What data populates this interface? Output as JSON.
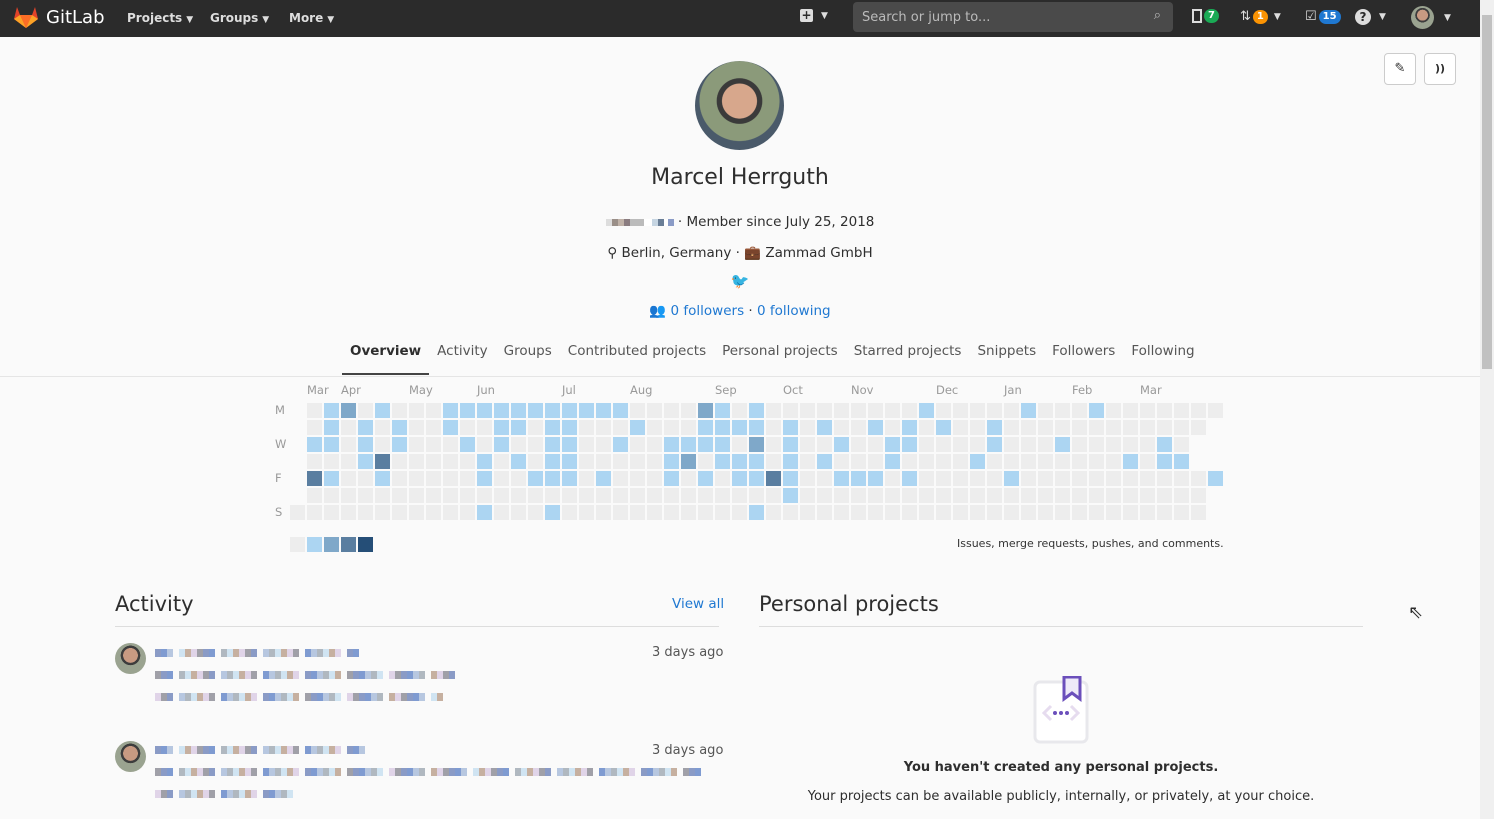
{
  "nav": {
    "brand": "GitLab",
    "menus": [
      "Projects",
      "Groups",
      "More"
    ],
    "search_placeholder": "Search or jump to...",
    "issues_count": "7",
    "mr_count": "1",
    "todos_count": "15"
  },
  "profile": {
    "name": "Marcel Herrguth",
    "member_since": "Member since July 25, 2018",
    "location": "Berlin, Germany",
    "organization": "Zammad GmbH",
    "followers": "0 followers",
    "following": "0 following"
  },
  "tabs": [
    "Overview",
    "Activity",
    "Groups",
    "Contributed projects",
    "Personal projects",
    "Starred projects",
    "Snippets",
    "Followers",
    "Following"
  ],
  "calendar": {
    "months": [
      {
        "label": "Mar",
        "col": 1
      },
      {
        "label": "Apr",
        "col": 3
      },
      {
        "label": "May",
        "col": 7
      },
      {
        "label": "Jun",
        "col": 11
      },
      {
        "label": "Jul",
        "col": 16
      },
      {
        "label": "Aug",
        "col": 20
      },
      {
        "label": "Sep",
        "col": 25
      },
      {
        "label": "Oct",
        "col": 29
      },
      {
        "label": "Nov",
        "col": 33
      },
      {
        "label": "Dec",
        "col": 38
      },
      {
        "label": "Jan",
        "col": 42
      },
      {
        "label": "Feb",
        "col": 46
      },
      {
        "label": "Mar",
        "col": 50
      }
    ],
    "day_labels": [
      "M",
      "",
      "W",
      "",
      "F",
      "",
      "S"
    ],
    "levels": [
      ".012010001111111111100002101000000000100000100010000000",
      ".01010100100110110001000111101010010101001000000000000.",
      ".1101010001010011001001111020100100110000100010000010.",
      ".000130000010101100000120111010100010000100000000101 1.",
      ".310010000010011101000101011310011101000001000000000001.",
      ".00000000000000000000000000001000000000000000000000000.",
      "000000000001000100000000000100000000000000000000000000."
    ],
    "colors": [
      "#ededed",
      "#acd5f2",
      "#7fa8c9",
      "#5a7ea0",
      "#254e77"
    ],
    "legend_note": "Issues, merge requests, pushes, and comments."
  },
  "activity": {
    "title": "Activity",
    "view_all": "View all",
    "events": [
      {
        "time": "3 days ago"
      },
      {
        "time": "3 days ago"
      }
    ]
  },
  "personal_projects": {
    "title": "Personal projects",
    "empty_title": "You haven't created any personal projects.",
    "empty_text": "Your projects can be available publicly, internally, or privately, at your choice."
  }
}
